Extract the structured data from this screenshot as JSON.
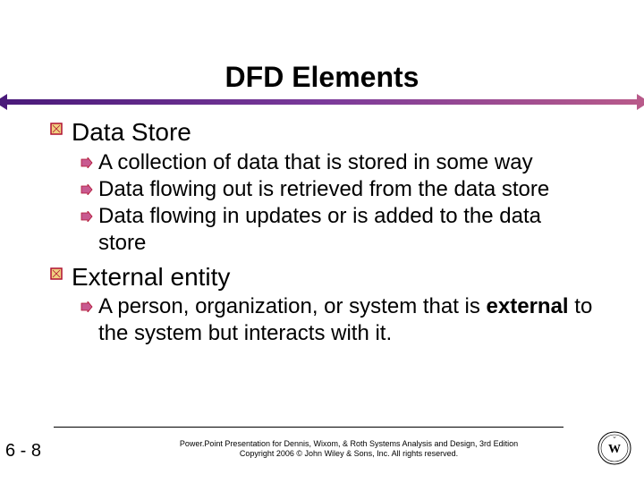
{
  "title": "DFD Elements",
  "colors": {
    "arrow_left": "#4a1a7a",
    "arrow_right": "#b85a8a",
    "bullet_border": "#b01030",
    "bullet_fill_l1": "#f0d080",
    "bullet_fill_l2": "#c85a90"
  },
  "sections": [
    {
      "heading": "Data Store",
      "items": [
        "A collection of data that is stored in some way",
        "Data flowing out is retrieved from the data store",
        "Data flowing in updates or is added to the data store"
      ]
    },
    {
      "heading": "External entity",
      "items_html": [
        "A person, organization, or system that is <b>external</b> to the system but interacts with it."
      ]
    }
  ],
  "footer": {
    "line1": "Power.Point Presentation for Dennis, Wixom, & Roth Systems Analysis and Design, 3rd Edition",
    "line2": "Copyright 2006 © John Wiley & Sons, Inc. All rights reserved."
  },
  "page_number": "6 - 8",
  "logo_name": "WILEY"
}
